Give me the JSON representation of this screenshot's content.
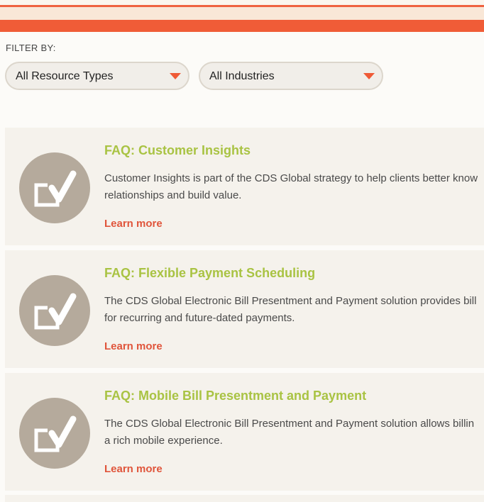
{
  "filter": {
    "label": "FILTER BY:",
    "resource_type": "All Resource Types",
    "industry": "All Industries"
  },
  "colors": {
    "accent": "#f05c37",
    "title_green": "#a9c343",
    "link_orange": "#e0553b",
    "icon_circle": "#b5aa9c"
  },
  "cards": [
    {
      "icon": "checkbox-check-icon",
      "title": "FAQ: Customer Insights",
      "desc_line1": "Customer Insights is part of the CDS Global strategy to help clients better know",
      "desc_line2": "relationships and build value.",
      "link": "Learn more"
    },
    {
      "icon": "checkbox-check-icon",
      "title": "FAQ: Flexible Payment Scheduling",
      "desc_line1": "The CDS Global Electronic Bill Presentment and Payment solution provides bill",
      "desc_line2": "for recurring and future-dated payments.",
      "link": "Learn more"
    },
    {
      "icon": "checkbox-check-icon",
      "title": "FAQ: Mobile Bill Presentment and Payment",
      "desc_line1": "The CDS Global Electronic Bill Presentment and Payment solution allows billin",
      "desc_line2": "a rich mobile experience.",
      "link": "Learn more"
    }
  ]
}
